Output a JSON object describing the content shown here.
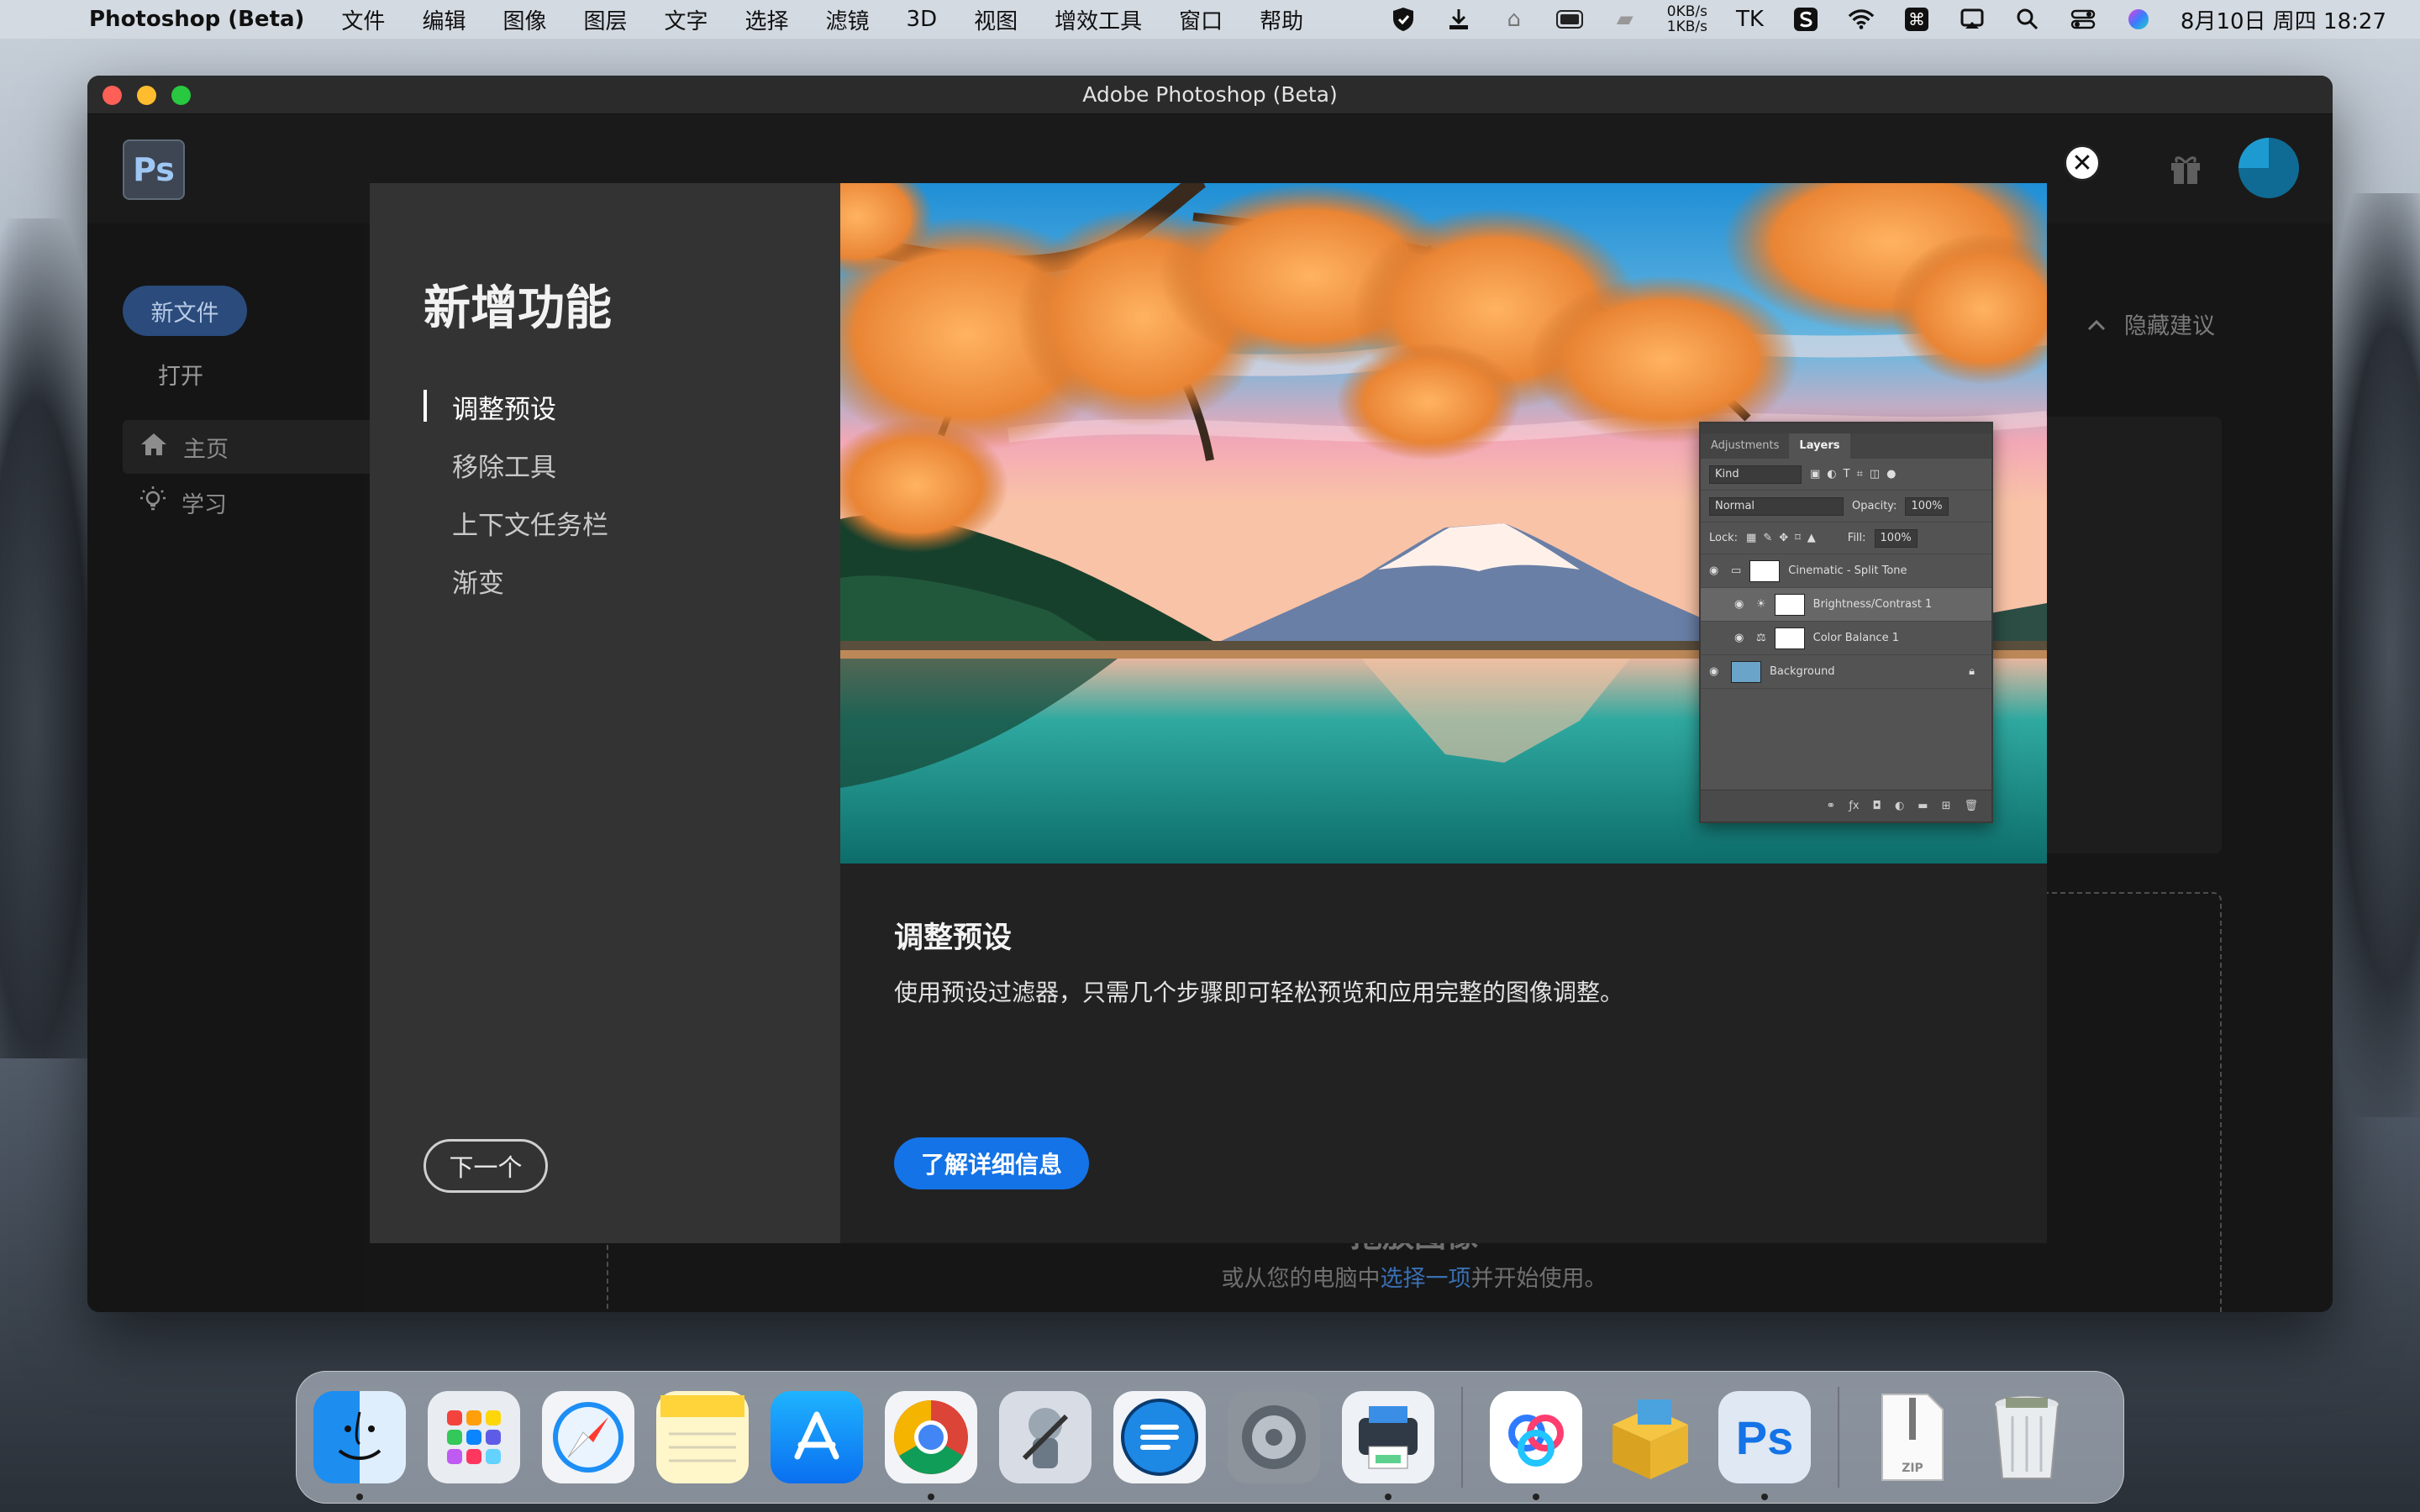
{
  "menubar": {
    "app_name": "Photoshop (Beta)",
    "menus": [
      "文件",
      "编辑",
      "图像",
      "图层",
      "文字",
      "选择",
      "滤镜",
      "3D",
      "视图",
      "增效工具",
      "窗口",
      "帮助"
    ],
    "net_up": "0KB/s",
    "net_down": "1KB/s",
    "input_method": "TK",
    "datetime": "8月10日 周四  18:27"
  },
  "window": {
    "title": "Adobe Photoshop (Beta)"
  },
  "ps": {
    "logo": "Ps",
    "new_file": "新文件",
    "open": "打开",
    "nav_home": "主页",
    "nav_learn": "学习",
    "hide_suggestions": "隐藏建议",
    "drop_title": "拖放图像",
    "drop_sub_before": "或从您的电脑中",
    "drop_sub_link": "选择一项",
    "drop_sub_after": "并开始使用。"
  },
  "dialog": {
    "title": "新增功能",
    "features": [
      "调整预设",
      "移除工具",
      "上下文任务栏",
      "渐变"
    ],
    "active_feature": 0,
    "next_button": "下一个",
    "heading": "调整预设",
    "description": "使用预设过滤器，只需几个步骤即可轻松预览和应用完整的图像调整。",
    "learn_more": "了解详细信息"
  },
  "layers_panel": {
    "tab_adjustments": "Adjustments",
    "tab_layers": "Layers",
    "kind": "Kind",
    "blend_mode": "Normal",
    "opacity_label": "Opacity:",
    "opacity_value": "100%",
    "lock_label": "Lock:",
    "fill_label": "Fill:",
    "fill_value": "100%",
    "layers": [
      "Cinematic - Split Tone",
      "Brightness/Contrast 1",
      "Color Balance 1",
      "Background"
    ]
  },
  "dock": {
    "apps": [
      "Finder",
      "Launchpad",
      "Safari",
      "Notes",
      "App Store",
      "Chrome",
      "Automator",
      "Craft",
      "System Preferences",
      "Printer",
      "Baidu Netdisk",
      "Archiver",
      "Photoshop",
      "ZIP",
      "Trash"
    ]
  },
  "colors": {
    "accent_blue": "#1473e6",
    "dialog_left_bg": "#333333",
    "dialog_right_bg": "#222222"
  }
}
